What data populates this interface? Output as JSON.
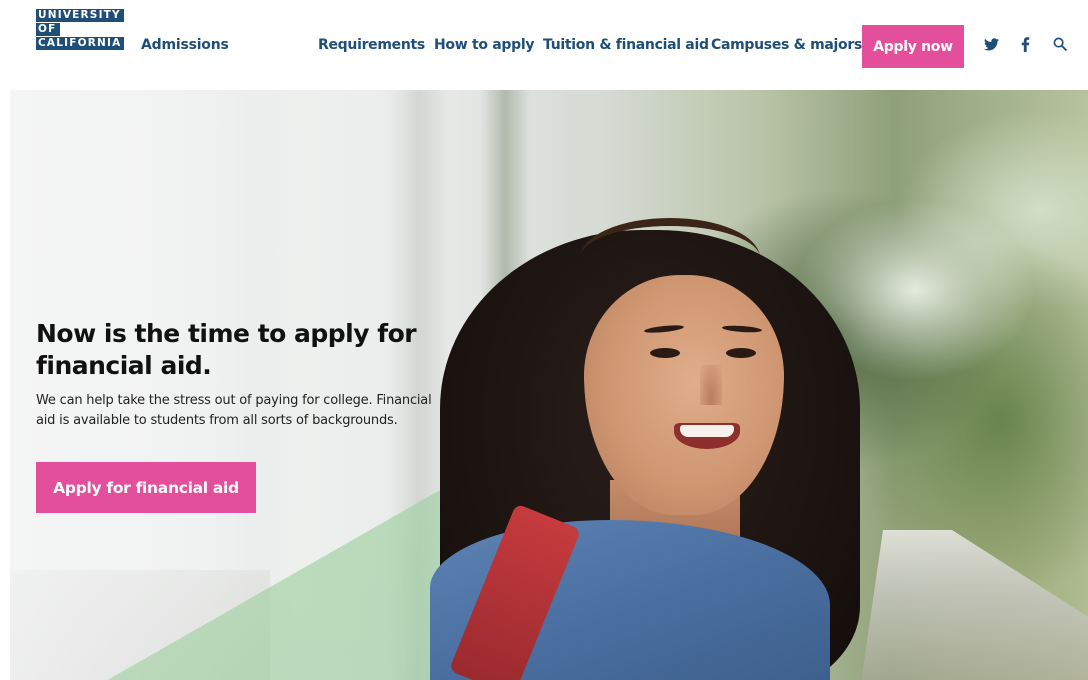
{
  "header": {
    "logo_lines": [
      "UNIVERSITY",
      "OF",
      "CALIFORNIA"
    ],
    "site_name": "Admissions",
    "nav": [
      {
        "label": "Requirements"
      },
      {
        "label": "How to apply"
      },
      {
        "label": "Tuition & financial aid"
      },
      {
        "label": "Campuses & majors"
      }
    ],
    "apply_now_label": "Apply now",
    "social_icons": [
      "twitter-icon",
      "facebook-icon"
    ],
    "search_icon": "search-icon"
  },
  "hero": {
    "title": "Now is the time to apply for financial aid.",
    "body": "We can help take the stress out of paying for college. Financial aid is available to students from all sorts of backgrounds.",
    "cta_label": "Apply for financial aid"
  },
  "colors": {
    "brand_blue": "#1f4e79",
    "cta_pink": "#e34f9a"
  }
}
